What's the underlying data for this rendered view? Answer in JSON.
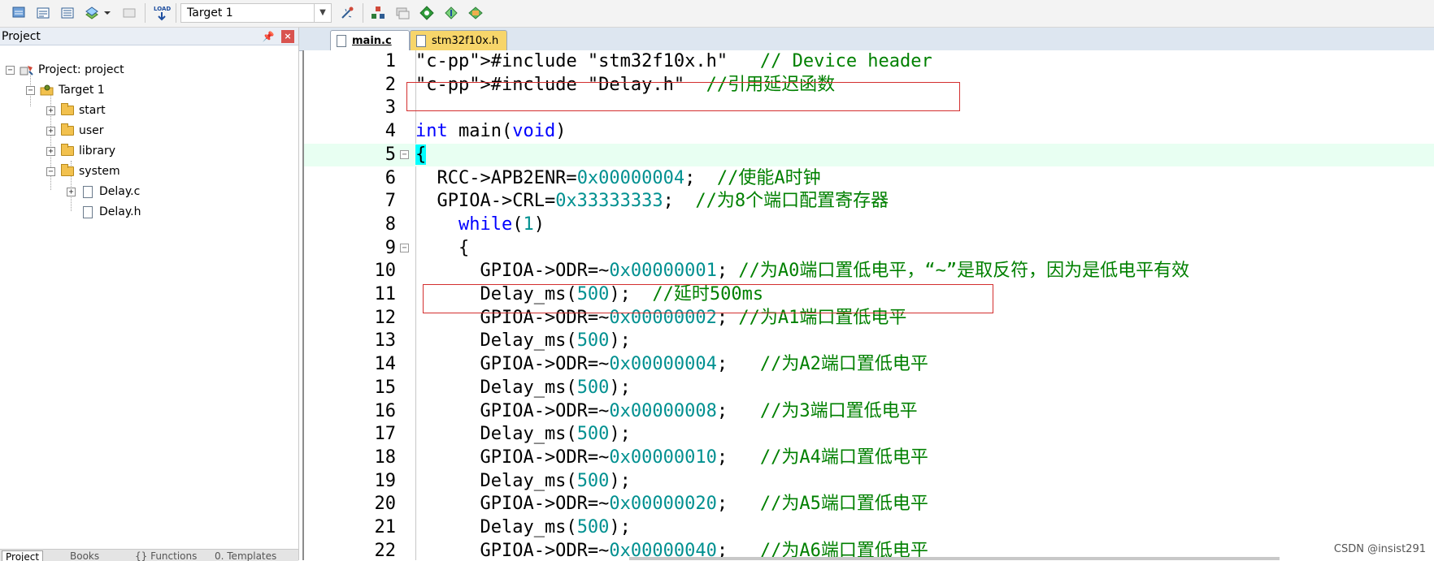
{
  "toolbar": {
    "buttons": [
      "translate-icon",
      "build-icon",
      "rebuild-icon",
      "batch-build-icon",
      "stop-build-icon",
      "download-icon",
      "options-icon",
      "manage-components-icon",
      "select-packs-icon",
      "inspect-icon",
      "pack-installer-icon"
    ],
    "download_label": "LOAD",
    "target": "Target 1"
  },
  "project_panel": {
    "title": "Project",
    "tree": [
      {
        "label": "Project: project",
        "level": 0,
        "expanded": true,
        "icon": "project-icon"
      },
      {
        "label": "Target 1",
        "level": 1,
        "expanded": true,
        "icon": "target-icon"
      },
      {
        "label": "start",
        "level": 2,
        "expanded": false,
        "icon": "folder-icon"
      },
      {
        "label": "user",
        "level": 2,
        "expanded": false,
        "icon": "folder-icon"
      },
      {
        "label": "library",
        "level": 2,
        "expanded": false,
        "icon": "folder-icon"
      },
      {
        "label": "system",
        "level": 2,
        "expanded": true,
        "icon": "folder-icon"
      },
      {
        "label": "Delay.c",
        "level": 3,
        "expanded": false,
        "icon": "file-icon"
      },
      {
        "label": "Delay.h",
        "level": 3,
        "expanded": null,
        "icon": "file-icon"
      }
    ],
    "bottom_tabs": [
      "Project",
      "Books",
      "{} Functions",
      "0. Templates"
    ]
  },
  "editor": {
    "tabs": [
      {
        "label": "main.c",
        "active": true
      },
      {
        "label": "stm32f10x.h",
        "active": false
      }
    ],
    "lines": [
      {
        "n": "1",
        "text": "#include \"stm32f10x.h\"   // Device header"
      },
      {
        "n": "2",
        "text": "#include \"Delay.h\"  //引用延迟函数"
      },
      {
        "n": "3",
        "text": ""
      },
      {
        "n": "4",
        "text": "int main(void)"
      },
      {
        "n": "5",
        "text": "{"
      },
      {
        "n": "6",
        "text": "  RCC->APB2ENR=0x00000004;  //使能A时钟"
      },
      {
        "n": "7",
        "text": "  GPIOA->CRL=0x33333333;  //为8个端口配置寄存器"
      },
      {
        "n": "8",
        "text": "    while(1)"
      },
      {
        "n": "9",
        "text": "    {"
      },
      {
        "n": "10",
        "text": "      GPIOA->ODR=~0x00000001; //为A0端口置低电平，“~”是取反符，因为是低电平有效"
      },
      {
        "n": "11",
        "text": "      Delay_ms(500);  //延时500ms"
      },
      {
        "n": "12",
        "text": "      GPIOA->ODR=~0x00000002; //为A1端口置低电平"
      },
      {
        "n": "13",
        "text": "      Delay_ms(500);"
      },
      {
        "n": "14",
        "text": "      GPIOA->ODR=~0x00000004;   //为A2端口置低电平"
      },
      {
        "n": "15",
        "text": "      Delay_ms(500);"
      },
      {
        "n": "16",
        "text": "      GPIOA->ODR=~0x00000008;   //为3端口置低电平"
      },
      {
        "n": "17",
        "text": "      Delay_ms(500);"
      },
      {
        "n": "18",
        "text": "      GPIOA->ODR=~0x00000010;   //为A4端口置低电平"
      },
      {
        "n": "19",
        "text": "      Delay_ms(500);"
      },
      {
        "n": "20",
        "text": "      GPIOA->ODR=~0x00000020;   //为A5端口置低电平"
      },
      {
        "n": "21",
        "text": "      Delay_ms(500);"
      },
      {
        "n": "22",
        "text": "      GPIOA->ODR=~0x00000040;   //为A6端口置低电平"
      }
    ],
    "current_line": "5"
  },
  "watermark": "CSDN @insist291"
}
